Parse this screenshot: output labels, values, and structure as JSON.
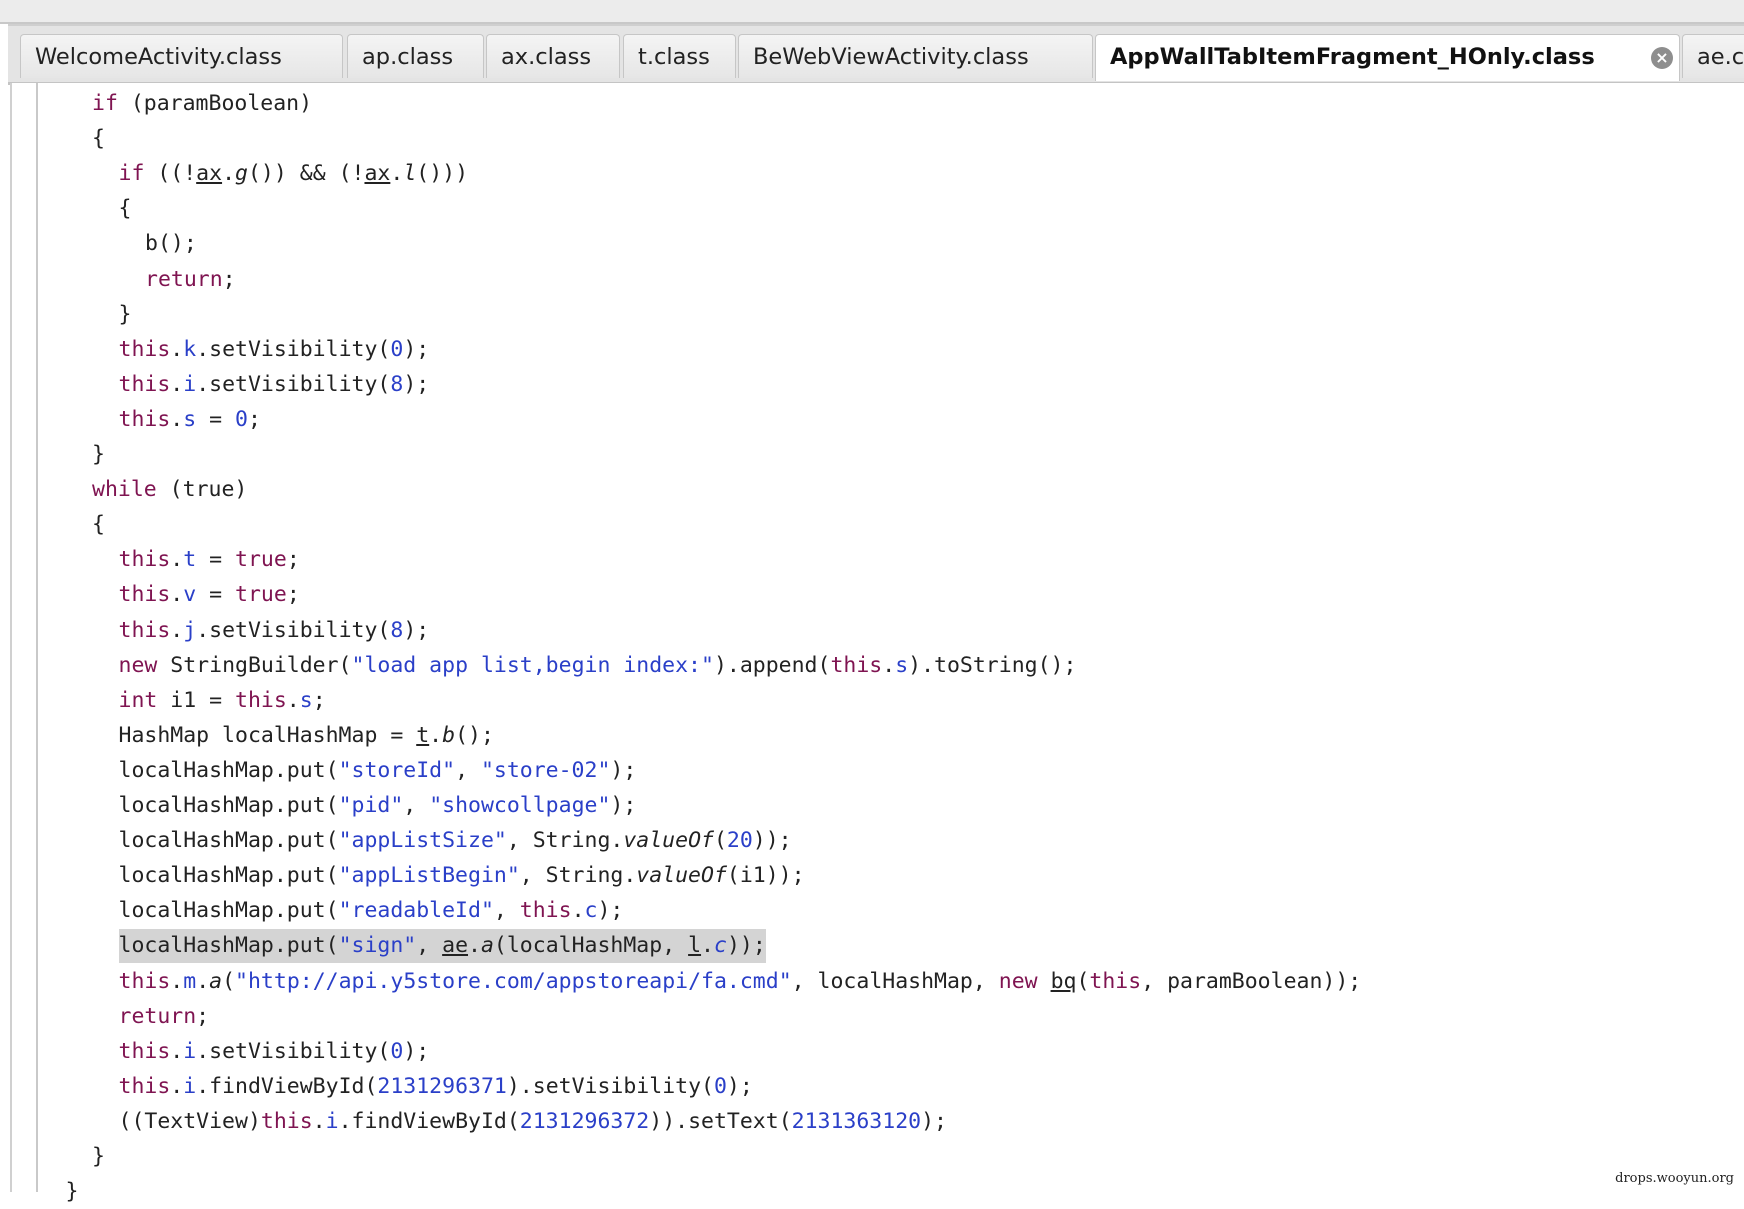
{
  "tabs": [
    {
      "label": "WelcomeActivity.class",
      "active": false
    },
    {
      "label": "ap.class",
      "active": false
    },
    {
      "label": "ax.class",
      "active": false
    },
    {
      "label": "t.class",
      "active": false
    },
    {
      "label": "BeWebViewActivity.class",
      "active": false
    },
    {
      "label": "AppWallTabItemFragment_HOnly.class",
      "active": true,
      "close_icon": "close-circle-icon"
    },
    {
      "label": "ae.class",
      "active": false
    }
  ],
  "colors": {
    "keyword": "#7f1451",
    "field_string_number": "#2a3fc8",
    "highlight": "#d4d4d4"
  },
  "code": [
    {
      "indent": 0,
      "tokens": [
        [
          "k",
          "if"
        ],
        [
          "p",
          " (paramBoolean)"
        ]
      ]
    },
    {
      "indent": 0,
      "tokens": [
        [
          "p",
          "{"
        ]
      ]
    },
    {
      "indent": 1,
      "tokens": [
        [
          "k",
          "if"
        ],
        [
          "p",
          " ((!"
        ],
        [
          "u",
          "ax"
        ],
        [
          "p",
          "."
        ],
        [
          "it",
          "g"
        ],
        [
          "p",
          "()) && (!"
        ],
        [
          "u",
          "ax"
        ],
        [
          "p",
          "."
        ],
        [
          "it",
          "l"
        ],
        [
          "p",
          "()))"
        ]
      ]
    },
    {
      "indent": 1,
      "tokens": [
        [
          "p",
          "{"
        ]
      ]
    },
    {
      "indent": 2,
      "tokens": [
        [
          "p",
          "b();"
        ]
      ]
    },
    {
      "indent": 2,
      "tokens": [
        [
          "k",
          "return"
        ],
        [
          "p",
          ";"
        ]
      ]
    },
    {
      "indent": 1,
      "tokens": [
        [
          "p",
          "}"
        ]
      ]
    },
    {
      "indent": 1,
      "tokens": [
        [
          "k",
          "this"
        ],
        [
          "p",
          "."
        ],
        [
          "f",
          "k"
        ],
        [
          "p",
          ".setVisibility("
        ],
        [
          "n",
          "0"
        ],
        [
          "p",
          ");"
        ]
      ]
    },
    {
      "indent": 1,
      "tokens": [
        [
          "k",
          "this"
        ],
        [
          "p",
          "."
        ],
        [
          "f",
          "i"
        ],
        [
          "p",
          ".setVisibility("
        ],
        [
          "n",
          "8"
        ],
        [
          "p",
          ");"
        ]
      ]
    },
    {
      "indent": 1,
      "tokens": [
        [
          "k",
          "this"
        ],
        [
          "p",
          "."
        ],
        [
          "f",
          "s"
        ],
        [
          "p",
          " = "
        ],
        [
          "n",
          "0"
        ],
        [
          "p",
          ";"
        ]
      ]
    },
    {
      "indent": 0,
      "tokens": [
        [
          "p",
          "}"
        ]
      ]
    },
    {
      "indent": 0,
      "tokens": [
        [
          "k",
          "while"
        ],
        [
          "p",
          " (true)"
        ]
      ]
    },
    {
      "indent": 0,
      "tokens": [
        [
          "p",
          "{"
        ]
      ]
    },
    {
      "indent": 1,
      "tokens": [
        [
          "k",
          "this"
        ],
        [
          "p",
          "."
        ],
        [
          "f",
          "t"
        ],
        [
          "p",
          " = "
        ],
        [
          "k",
          "true"
        ],
        [
          "p",
          ";"
        ]
      ]
    },
    {
      "indent": 1,
      "tokens": [
        [
          "k",
          "this"
        ],
        [
          "p",
          "."
        ],
        [
          "f",
          "v"
        ],
        [
          "p",
          " = "
        ],
        [
          "k",
          "true"
        ],
        [
          "p",
          ";"
        ]
      ]
    },
    {
      "indent": 1,
      "tokens": [
        [
          "k",
          "this"
        ],
        [
          "p",
          "."
        ],
        [
          "f",
          "j"
        ],
        [
          "p",
          ".setVisibility("
        ],
        [
          "n",
          "8"
        ],
        [
          "p",
          ");"
        ]
      ]
    },
    {
      "indent": 1,
      "tokens": [
        [
          "k",
          "new"
        ],
        [
          "p",
          " StringBuilder("
        ],
        [
          "s",
          "\"load app list,begin index:\""
        ],
        [
          "p",
          ").append("
        ],
        [
          "k",
          "this"
        ],
        [
          "p",
          "."
        ],
        [
          "f",
          "s"
        ],
        [
          "p",
          ").toString();"
        ]
      ]
    },
    {
      "indent": 1,
      "tokens": [
        [
          "k",
          "int"
        ],
        [
          "p",
          " i1 = "
        ],
        [
          "k",
          "this"
        ],
        [
          "p",
          "."
        ],
        [
          "f",
          "s"
        ],
        [
          "p",
          ";"
        ]
      ]
    },
    {
      "indent": 1,
      "tokens": [
        [
          "p",
          "HashMap localHashMap = "
        ],
        [
          "u",
          "t"
        ],
        [
          "p",
          "."
        ],
        [
          "it",
          "b"
        ],
        [
          "p",
          "();"
        ]
      ]
    },
    {
      "indent": 1,
      "tokens": [
        [
          "p",
          "localHashMap.put("
        ],
        [
          "s",
          "\"storeId\""
        ],
        [
          "p",
          ", "
        ],
        [
          "s",
          "\"store-02\""
        ],
        [
          "p",
          ");"
        ]
      ]
    },
    {
      "indent": 1,
      "tokens": [
        [
          "p",
          "localHashMap.put("
        ],
        [
          "s",
          "\"pid\""
        ],
        [
          "p",
          ", "
        ],
        [
          "s",
          "\"showcollpage\""
        ],
        [
          "p",
          ");"
        ]
      ]
    },
    {
      "indent": 1,
      "tokens": [
        [
          "p",
          "localHashMap.put("
        ],
        [
          "s",
          "\"appListSize\""
        ],
        [
          "p",
          ", String."
        ],
        [
          "it",
          "valueOf"
        ],
        [
          "p",
          "("
        ],
        [
          "n",
          "20"
        ],
        [
          "p",
          "));"
        ]
      ]
    },
    {
      "indent": 1,
      "tokens": [
        [
          "p",
          "localHashMap.put("
        ],
        [
          "s",
          "\"appListBegin\""
        ],
        [
          "p",
          ", String."
        ],
        [
          "it",
          "valueOf"
        ],
        [
          "p",
          "(i1));"
        ]
      ]
    },
    {
      "indent": 1,
      "tokens": [
        [
          "p",
          "localHashMap.put("
        ],
        [
          "s",
          "\"readableId\""
        ],
        [
          "p",
          ", "
        ],
        [
          "k",
          "this"
        ],
        [
          "p",
          "."
        ],
        [
          "f",
          "c"
        ],
        [
          "p",
          ");"
        ]
      ]
    },
    {
      "indent": 1,
      "highlight": true,
      "tokens": [
        [
          "p",
          "localHashMap.put("
        ],
        [
          "s",
          "\"sign\""
        ],
        [
          "p",
          ", "
        ],
        [
          "u",
          "ae"
        ],
        [
          "p",
          "."
        ],
        [
          "it",
          "a"
        ],
        [
          "p",
          "(localHashMap, "
        ],
        [
          "u",
          "l"
        ],
        [
          "p",
          "."
        ],
        [
          "fi",
          "c"
        ],
        [
          "p",
          "));"
        ]
      ]
    },
    {
      "indent": 1,
      "tokens": [
        [
          "k",
          "this"
        ],
        [
          "p",
          "."
        ],
        [
          "f",
          "m"
        ],
        [
          "p",
          "."
        ],
        [
          "it",
          "a"
        ],
        [
          "p",
          "("
        ],
        [
          "s",
          "\"http://api.y5store.com/appstoreapi/fa.cmd\""
        ],
        [
          "p",
          ", localHashMap, "
        ],
        [
          "k",
          "new"
        ],
        [
          "p",
          " "
        ],
        [
          "u",
          "bq"
        ],
        [
          "p",
          "("
        ],
        [
          "k",
          "this"
        ],
        [
          "p",
          ", paramBoolean));"
        ]
      ]
    },
    {
      "indent": 1,
      "tokens": [
        [
          "k",
          "return"
        ],
        [
          "p",
          ";"
        ]
      ]
    },
    {
      "indent": 1,
      "tokens": [
        [
          "k",
          "this"
        ],
        [
          "p",
          "."
        ],
        [
          "f",
          "i"
        ],
        [
          "p",
          ".setVisibility("
        ],
        [
          "n",
          "0"
        ],
        [
          "p",
          ");"
        ]
      ]
    },
    {
      "indent": 1,
      "tokens": [
        [
          "k",
          "this"
        ],
        [
          "p",
          "."
        ],
        [
          "f",
          "i"
        ],
        [
          "p",
          ".findViewById("
        ],
        [
          "n",
          "2131296371"
        ],
        [
          "p",
          ").setVisibility("
        ],
        [
          "n",
          "0"
        ],
        [
          "p",
          ");"
        ]
      ]
    },
    {
      "indent": 1,
      "tokens": [
        [
          "p",
          "((TextView)"
        ],
        [
          "k",
          "this"
        ],
        [
          "p",
          "."
        ],
        [
          "f",
          "i"
        ],
        [
          "p",
          ".findViewById("
        ],
        [
          "n",
          "2131296372"
        ],
        [
          "p",
          ")).setText("
        ],
        [
          "n",
          "2131363120"
        ],
        [
          "p",
          ");"
        ]
      ]
    },
    {
      "indent": 0,
      "tokens": [
        [
          "p",
          "}"
        ]
      ]
    },
    {
      "indent": -1,
      "tokens": [
        [
          "p",
          "}"
        ]
      ]
    }
  ],
  "watermark": "drops.wooyun.org"
}
